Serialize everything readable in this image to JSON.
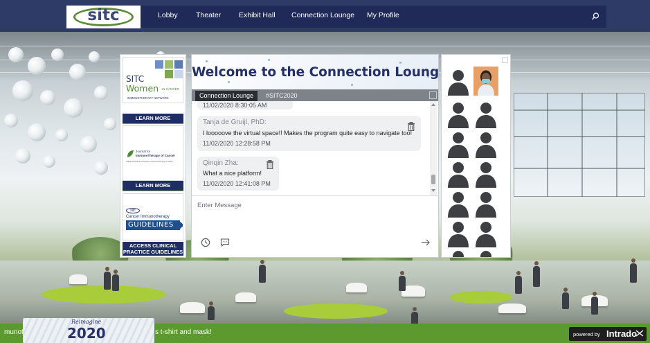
{
  "nav": {
    "logo": "sitc",
    "items": [
      "Lobby",
      "Theater",
      "Exhibit Hall",
      "Connection Lounge",
      "My Profile"
    ],
    "search_placeholder": ""
  },
  "ads": [
    {
      "title_line1": "SITC",
      "title_line2": "Women",
      "title_suffix": "IN CANCER",
      "subtitle": "IMMUNOTHERAPY NETWORK",
      "button": "LEARN MORE"
    },
    {
      "title_line1": "Journal for",
      "title_line2": "ImmunoTherapy of Cancer",
      "subtitle": "Official Journal of the Society for Immunotherapy of Cancer",
      "button": "LEARN MORE"
    },
    {
      "logo": "sitc",
      "title_line1": "Cancer Immunotherapy",
      "title_line2": "GUIDELINES",
      "button_line1": "ACCESS CLINICAL",
      "button_line2": "PRACTICE GUIDELINES"
    }
  ],
  "chat": {
    "banner_title": "Welcome to the Connection Lounge",
    "tabs": [
      "Connection Lounge",
      "#SITC2020"
    ],
    "active_tab": "Connection Lounge",
    "messages": [
      {
        "author": "",
        "text": "",
        "time": "11/02/2020 8:30:05 AM"
      },
      {
        "author": "Tanja de Gruijl, PhD:",
        "text": "I looooove the virtual space!! Makes the program quite easy to navigate too!",
        "time": "11/02/2020 12:28:58 PM"
      },
      {
        "author": "Qinqin Zha:",
        "text": "What a nice platform!",
        "time": "11/02/2020 12:41:08 PM"
      }
    ],
    "input_placeholder": "Enter Message",
    "icons": {
      "history": "clock-icon",
      "emoji": "chat-bubble-icon",
      "send": "arrow-right-icon"
    }
  },
  "participants": {
    "count_visible": 12,
    "first_has_photo": false,
    "second_has_photo": true
  },
  "footer": {
    "ticker_left": "munot",
    "ticker_right": "s t-shirt and mask!",
    "event_year": "2020",
    "event_script": "Reimagine",
    "powered_label": "powered by",
    "powered_brand": "Intrado",
    "colors": {
      "bar": "#5c9a2f",
      "nav": "#2f3b67",
      "accent": "#253163"
    }
  }
}
